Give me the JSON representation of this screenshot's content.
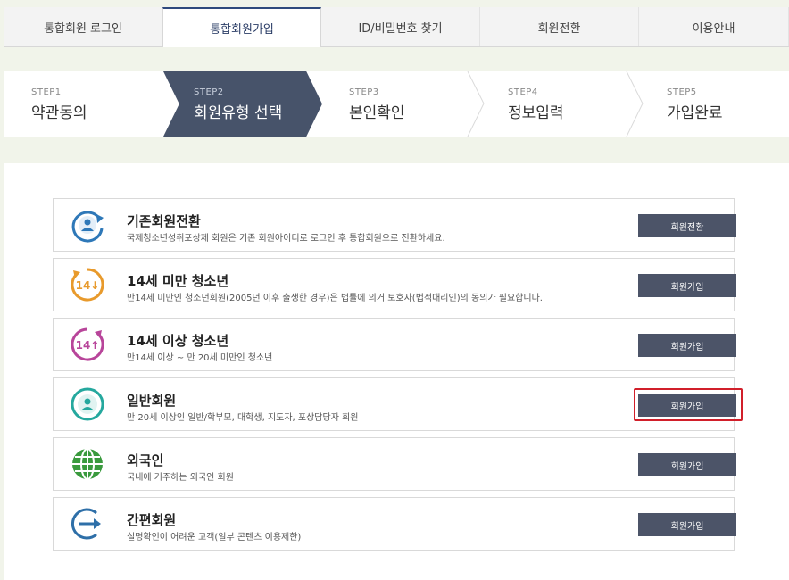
{
  "tabs": [
    {
      "label": "통합회원 로그인"
    },
    {
      "label": "통합회원가입"
    },
    {
      "label": "ID/비밀번호 찾기"
    },
    {
      "label": "회원전환"
    },
    {
      "label": "이용안내"
    }
  ],
  "steps": [
    {
      "num": "STEP1",
      "title": "약관동의"
    },
    {
      "num": "STEP2",
      "title": "회원유형 선택"
    },
    {
      "num": "STEP3",
      "title": "본인확인"
    },
    {
      "num": "STEP4",
      "title": "정보입력"
    },
    {
      "num": "STEP5",
      "title": "가입완료"
    }
  ],
  "member_types": [
    {
      "name": "기존회원전환",
      "desc": "국제청소년성취포상제 회원은 기존 회원아이디로 로그인 후 통합회원으로 전환하세요.",
      "button": "회원전환",
      "icon": "person-refresh-icon",
      "color": "#2e78b8"
    },
    {
      "name": "14세 미만 청소년",
      "desc": "만14세 미만인 청소년회원(2005년 이후 출생한 경우)은 법률에 의거 보호자(법적대리인)의 동의가 필요합니다.",
      "button": "회원가입",
      "icon": "age-under-14-icon",
      "icon_text": "14",
      "color": "#e89a2c"
    },
    {
      "name": "14세 이상 청소년",
      "desc": "만14세 이상 ~ 만 20세 미만인 청소년",
      "button": "회원가입",
      "icon": "age-over-14-icon",
      "icon_text": "14",
      "color": "#b8459a"
    },
    {
      "name": "일반회원",
      "desc": "만 20세 이상인 일반/학부모, 대학생, 지도자, 포상담당자 회원",
      "button": "회원가입",
      "icon": "person-icon",
      "color": "#25a89e"
    },
    {
      "name": "외국인",
      "desc": "국내에 거주하는 외국인 회원",
      "button": "회원가입",
      "icon": "globe-icon",
      "color": "#3a9a3e"
    },
    {
      "name": "간편회원",
      "desc": "실명확인이 어려운 고객(일부 콘텐츠 이용제한)",
      "button": "회원가입",
      "icon": "arrow-right-icon",
      "color": "#2e6fa8"
    }
  ]
}
